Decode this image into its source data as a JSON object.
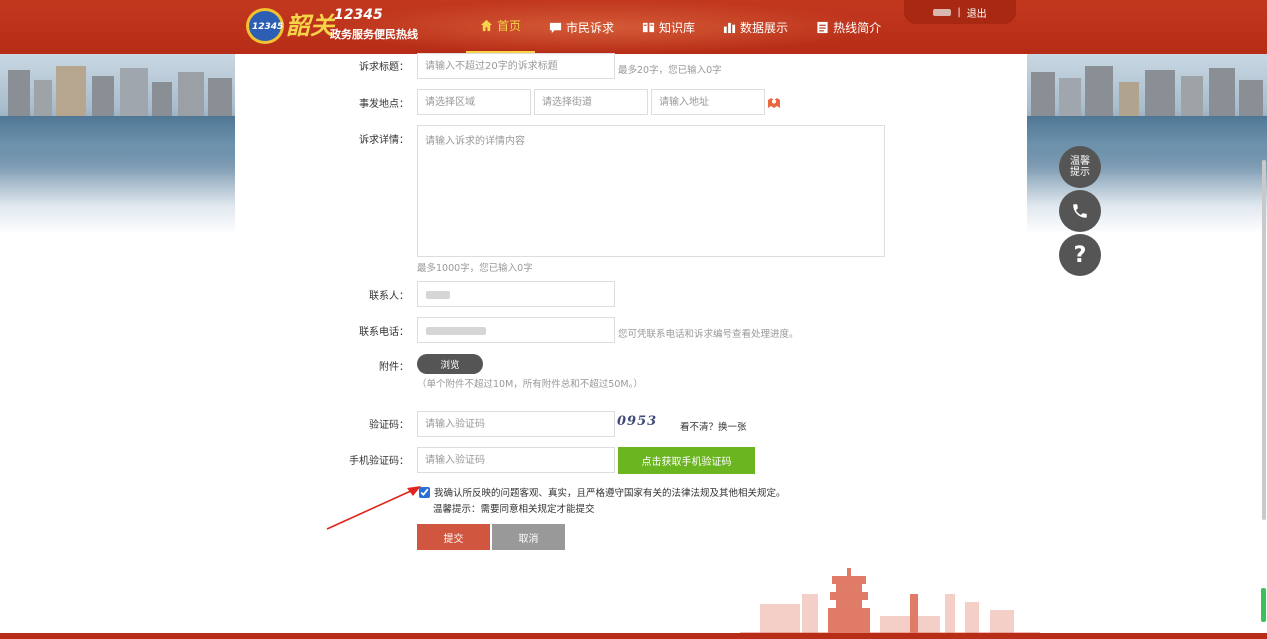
{
  "header": {
    "logo_emblem": "12345",
    "logo_script": "韶关",
    "logo_number": "12345",
    "logo_subtitle": "政务服务便民热线",
    "nav": [
      {
        "label": "首页",
        "icon": "home-icon",
        "active": true
      },
      {
        "label": "市民诉求",
        "icon": "chat-icon",
        "active": false
      },
      {
        "label": "知识库",
        "icon": "book-icon",
        "active": false
      },
      {
        "label": "数据展示",
        "icon": "bar-chart-icon",
        "active": false
      },
      {
        "label": "热线简介",
        "icon": "document-icon",
        "active": false
      }
    ],
    "user_separator": "|",
    "logout_label": "退出"
  },
  "form": {
    "title_label": "诉求标题：",
    "title_placeholder": "请输入不超过20字的诉求标题",
    "title_hint": "最多20字，您已输入0字",
    "location_label": "事发地点：",
    "region_placeholder": "请选择区域",
    "street_placeholder": "请选择街道",
    "address_placeholder": "请输入地址",
    "detail_label": "诉求详情：",
    "detail_placeholder": "请输入诉求的详情内容",
    "detail_hint": "最多1000字，您已输入0字",
    "contact_label": "联系人：",
    "phone_label": "联系电话：",
    "phone_hint": "您可凭联系电话和诉求编号查看处理进度。",
    "attachment_label": "附件：",
    "browse_label": "浏览",
    "attachment_hint": "（单个附件不超过10M，所有附件总和不超过50M。）",
    "captcha_label": "验证码：",
    "captcha_placeholder": "请输入验证码",
    "captcha_text": "0953",
    "captcha_refresh": "看不清？换一张",
    "sms_label": "手机验证码：",
    "sms_placeholder": "请输入验证码",
    "sms_button": "点击获取手机验证码",
    "agree_text": "我确认所反映的问题客观、真实，且严格遵守国家有关的法律法规及其他相关规定。",
    "agree_checked": true,
    "tip_text": "温馨提示：需要同意相关规定才能提交",
    "submit_label": "提交",
    "cancel_label": "取消"
  },
  "float": {
    "tip_line1": "温馨",
    "tip_line2": "提示",
    "phone_icon": "phone-icon",
    "help_label": "?"
  },
  "colors": {
    "header": "#c2381f",
    "accent_yellow": "#f7d34a",
    "submit": "#d0563f",
    "sms_button": "#6ab520",
    "cancel": "#999999",
    "float_button": "#555555"
  }
}
